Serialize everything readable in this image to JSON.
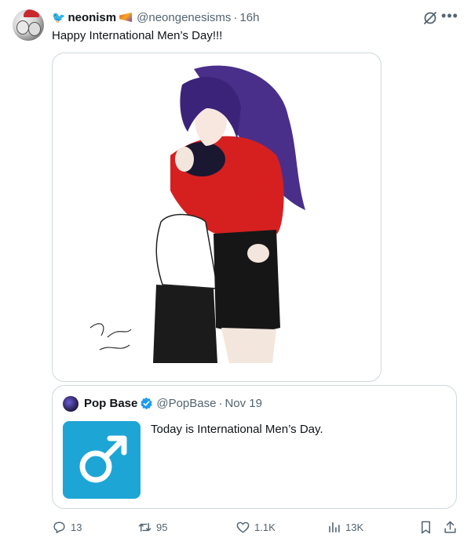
{
  "tweet": {
    "author_name": "neonism",
    "author_handle": "@neongenesisms",
    "separator": "·",
    "time": "16h",
    "text": "Happy International Men’s Day!!!",
    "icons": [
      "bird-emoji-icon",
      "flag-emoji-icon",
      "grok-icon",
      "more-icon"
    ]
  },
  "quote": {
    "author_name": "Pop Base",
    "author_handle": "@PopBase",
    "separator": "·",
    "date": "Nov 19",
    "text": "Today is International Men’s Day.",
    "thumb_symbol": "male-symbol",
    "thumb_color": "#1da5d6"
  },
  "actions": {
    "replies": "13",
    "reposts": "95",
    "likes": "1.1K",
    "views": "13K"
  },
  "colors": {
    "text": "#0f1419",
    "secondary": "#536471",
    "border": "#cfd9de",
    "verified": "#1d9bf0"
  }
}
